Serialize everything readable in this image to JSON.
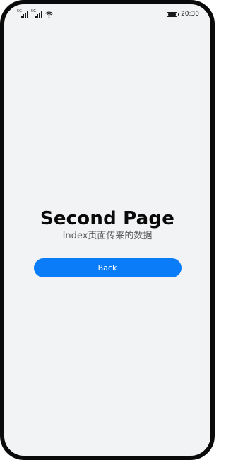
{
  "status_bar": {
    "sim1_label": "5G",
    "sim2_label": "5G",
    "time": "20:30",
    "battery_level": 1.0
  },
  "main": {
    "title": "Second Page",
    "subtitle": "Index页面传来的数据",
    "back_label": "Back"
  },
  "colors": {
    "background": "#f1f3f5",
    "accent": "#0a7cf8"
  }
}
